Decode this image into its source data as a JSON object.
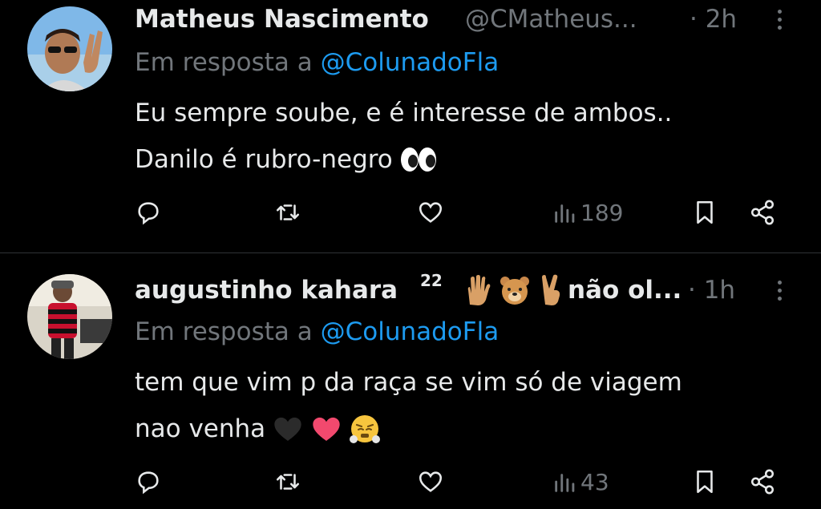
{
  "tweets": [
    {
      "name": "Matheus Nascimento",
      "handle": "@CMatheus...",
      "time": "· 2h",
      "reply_prefix": "Em resposta a",
      "reply_mention": "@ColunadoFla",
      "text_line1": "Eu sempre soube, e é interesse de ambos..",
      "text_line2": "Danilo é rubro-negro",
      "views": "189"
    },
    {
      "name": "augustinho kahara",
      "name_superscript": "22",
      "name_tail": "não ol...",
      "time": "· 1h",
      "reply_prefix": "Em resposta a",
      "reply_mention": "@ColunadoFla",
      "text_line1": "tem que vim p da raça se vim só de viagem",
      "text_line2": "nao venha",
      "views": "43"
    }
  ],
  "colors": {
    "background": "#000000",
    "text_primary": "#e7e9ea",
    "text_secondary": "#71767b",
    "accent": "#1d9bf0",
    "divider": "#2f3336"
  },
  "icons": [
    "reply-icon",
    "retweet-icon",
    "like-icon",
    "views-icon",
    "bookmark-icon",
    "share-icon",
    "more-icon"
  ]
}
